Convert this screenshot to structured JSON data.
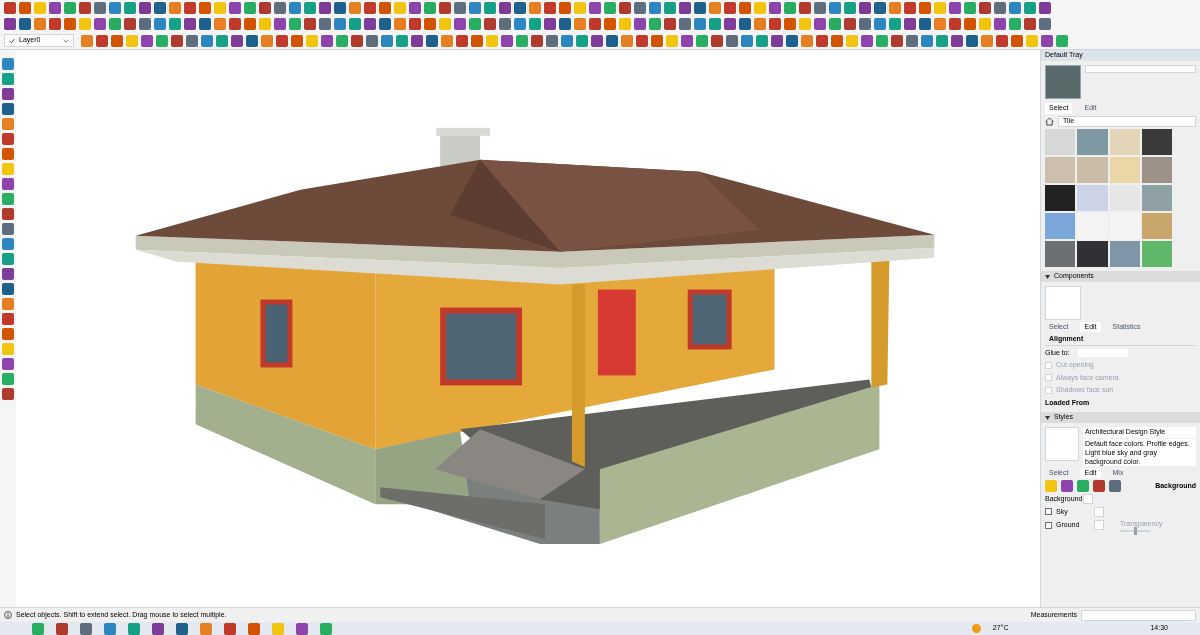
{
  "toolbar": {
    "layer": "Layer0"
  },
  "tray": {
    "title": "Default Tray",
    "materials": {
      "tabs": [
        {
          "label": "Select",
          "selected": true
        },
        {
          "label": "Edit",
          "selected": false
        }
      ],
      "collection": "Tile"
    },
    "components": {
      "title": "Components",
      "expanded": true,
      "tabs": [
        {
          "label": "Select",
          "selected": false
        },
        {
          "label": "Edit",
          "selected": true
        },
        {
          "label": "Statistics",
          "selected": false
        }
      ],
      "alignment": "Alignment",
      "glue_label": "Glue to:",
      "options": [
        {
          "label": "Cut opening",
          "checked": false
        },
        {
          "label": "Always face camera",
          "checked": false
        },
        {
          "label": "Shadows face sun",
          "checked": false
        }
      ],
      "loaded_from": "Loaded From"
    },
    "styles": {
      "title": "Styles",
      "expanded": true,
      "name": "Architectural Design Style",
      "description": "Default face colors. Profile edges. Light blue sky and gray background color.",
      "tabs": [
        {
          "label": "Select",
          "selected": false
        },
        {
          "label": "Edit",
          "selected": true
        },
        {
          "label": "Mix",
          "selected": false
        }
      ],
      "section": "Background",
      "settings": [
        {
          "label": "Background",
          "kind": "plain"
        },
        {
          "label": "Sky",
          "kind": "checkbox",
          "checked": false
        },
        {
          "label": "Ground",
          "kind": "checkbox",
          "checked": false
        }
      ],
      "transparency": {
        "label": "Transparency",
        "level": 0.5
      }
    }
  },
  "status": {
    "message": "Select objects. Shift to extend select. Drag mouse to select multiple.",
    "measurements_label": "Measurements"
  },
  "taskbar": {
    "temperature": "27°C",
    "time": "14:30"
  }
}
